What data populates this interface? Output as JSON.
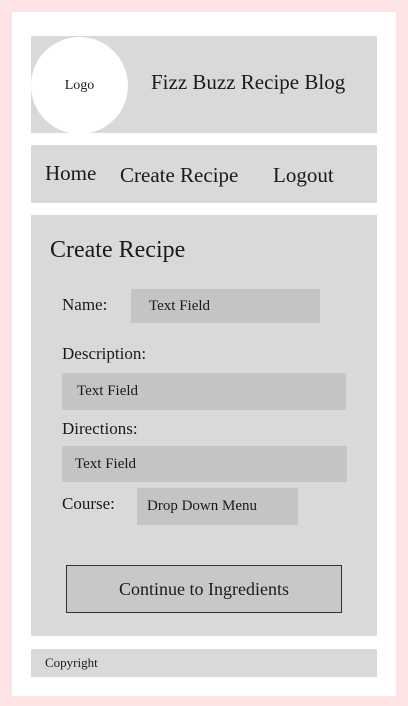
{
  "header": {
    "logo_text": "Logo",
    "site_title": "Fizz Buzz Recipe Blog"
  },
  "nav": {
    "items": [
      {
        "label": "Home"
      },
      {
        "label": "Create Recipe"
      },
      {
        "label": "Logout"
      }
    ]
  },
  "form": {
    "title": "Create Recipe",
    "name_label": "Name:",
    "name_field": "Text Field",
    "description_label": "Description:",
    "description_field": "Text Field",
    "directions_label": "Directions:",
    "directions_field": "Text Field",
    "course_label": "Course:",
    "course_select": "Drop Down Menu",
    "continue_label": "Continue to Ingredients"
  },
  "footer": {
    "copyright": "Copyright"
  },
  "colors": {
    "background": "#fde3e3",
    "page": "#ffffff",
    "panel": "#d9d9d9",
    "field": "#c4c4c4"
  }
}
